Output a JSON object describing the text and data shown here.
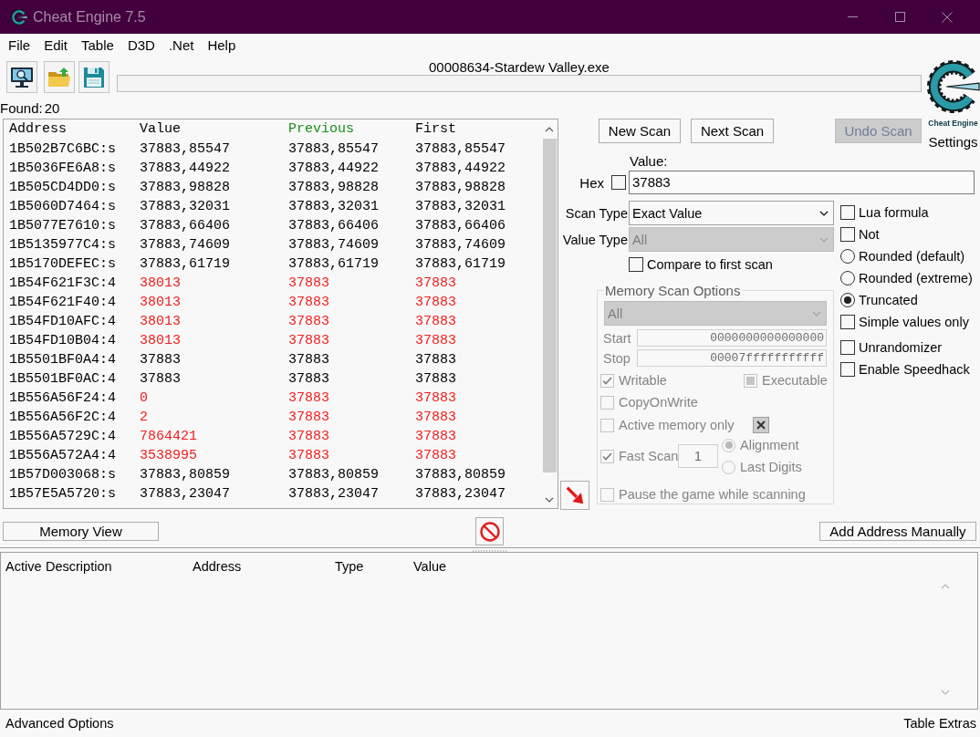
{
  "window": {
    "title": "Cheat Engine 7.5"
  },
  "menu": [
    {
      "label": "File"
    },
    {
      "label": "Edit"
    },
    {
      "label": "Table"
    },
    {
      "label": "D3D"
    },
    {
      "label": ".Net"
    },
    {
      "label": "Help"
    }
  ],
  "process": {
    "name": "00008634-Stardew Valley.exe",
    "progress": {
      "level": 0
    }
  },
  "found": {
    "label": "Found:",
    "count": "20"
  },
  "results": {
    "columns": [
      {
        "label": "Address",
        "color": "#000000"
      },
      {
        "label": "Value",
        "color": "#000000"
      },
      {
        "label": "Previous",
        "color": "#1a8f1a"
      },
      {
        "label": "First",
        "color": "#000000"
      }
    ],
    "rows": [
      {
        "address": "1B502B7C6BC:s",
        "value": "37883,85547",
        "previous": "37883,85547",
        "first": "37883,85547",
        "changed": false
      },
      {
        "address": "1B5036FE6A8:s",
        "value": "37883,44922",
        "previous": "37883,44922",
        "first": "37883,44922",
        "changed": false
      },
      {
        "address": "1B505CD4DD0:s",
        "value": "37883,98828",
        "previous": "37883,98828",
        "first": "37883,98828",
        "changed": false
      },
      {
        "address": "1B5060D7464:s",
        "value": "37883,32031",
        "previous": "37883,32031",
        "first": "37883,32031",
        "changed": false
      },
      {
        "address": "1B5077E7610:s",
        "value": "37883,66406",
        "previous": "37883,66406",
        "first": "37883,66406",
        "changed": false
      },
      {
        "address": "1B5135977C4:s",
        "value": "37883,74609",
        "previous": "37883,74609",
        "first": "37883,74609",
        "changed": false
      },
      {
        "address": "1B5170DEFEC:s",
        "value": "37883,61719",
        "previous": "37883,61719",
        "first": "37883,61719",
        "changed": false
      },
      {
        "address": "1B54F621F3C:4",
        "value": "38013",
        "previous": "37883",
        "first": "37883",
        "changed": true
      },
      {
        "address": "1B54F621F40:4",
        "value": "38013",
        "previous": "37883",
        "first": "37883",
        "changed": true
      },
      {
        "address": "1B54FD10AFC:4",
        "value": "38013",
        "previous": "37883",
        "first": "37883",
        "changed": true
      },
      {
        "address": "1B54FD10B04:4",
        "value": "38013",
        "previous": "37883",
        "first": "37883",
        "changed": true
      },
      {
        "address": "1B5501BF0A4:4",
        "value": "37883",
        "previous": "37883",
        "first": "37883",
        "changed": false
      },
      {
        "address": "1B5501BF0AC:4",
        "value": "37883",
        "previous": "37883",
        "first": "37883",
        "changed": false
      },
      {
        "address": "1B556A56F24:4",
        "value": "0",
        "previous": "37883",
        "first": "37883",
        "changed": true
      },
      {
        "address": "1B556A56F2C:4",
        "value": "2",
        "previous": "37883",
        "first": "37883",
        "changed": true
      },
      {
        "address": "1B556A5729C:4",
        "value": "7864421",
        "previous": "37883",
        "first": "37883",
        "changed": true
      },
      {
        "address": "1B556A572A4:4",
        "value": "3538995",
        "previous": "37883",
        "first": "37883",
        "changed": true
      },
      {
        "address": "1B57D003068:s",
        "value": "37883,80859",
        "previous": "37883,80859",
        "first": "37883,80859",
        "changed": false
      },
      {
        "address": "1B57E5A5720:s",
        "value": "37883,23047",
        "previous": "37883,23047",
        "first": "37883,23047",
        "changed": false
      }
    ]
  },
  "scan_buttons": [
    {
      "label": "New Scan",
      "disabled": false
    },
    {
      "label": "Next Scan",
      "disabled": false
    },
    {
      "label": "Undo Scan",
      "disabled": true
    }
  ],
  "logo": {
    "wordmark": "Cheat Engine",
    "caption": "Settings"
  },
  "value": {
    "label": "Value:",
    "value": "37883",
    "hex": {
      "label": "Hex",
      "checked": false
    }
  },
  "scan_type": {
    "label": "Scan Type",
    "value": "Exact Value",
    "disabled": false
  },
  "value_type": {
    "label": "Value Type",
    "value": "All",
    "disabled": true
  },
  "compare_to_first_scan": {
    "label": "Compare to first scan",
    "checked": false
  },
  "memory_scan_options": {
    "title": "Memory Scan Options",
    "disabled": true,
    "region": {
      "value": "All"
    },
    "start": {
      "label": "Start",
      "value": "0000000000000000"
    },
    "stop": {
      "label": "Stop",
      "value": "00007fffffffffff"
    },
    "writable": {
      "label": "Writable",
      "checked": true
    },
    "executable": {
      "label": "Executable",
      "checked": false,
      "indeterminate": true
    },
    "copy_on_write": {
      "label": "CopyOnWrite",
      "checked": false
    },
    "active_memory_only": {
      "label": "Active memory only",
      "checked": false
    },
    "fast_scan": {
      "label": "Fast Scan",
      "checked": true,
      "value": "1"
    },
    "alignment": [
      {
        "label": "Alignment",
        "selected": true
      },
      {
        "label": "Last Digits",
        "selected": false
      }
    ],
    "pause_game": {
      "label": "Pause the game while scanning",
      "checked": false
    }
  },
  "scan_options": [
    {
      "kind": "checkbox",
      "label": "Lua formula",
      "checked": false
    },
    {
      "kind": "checkbox",
      "label": "Not",
      "checked": false
    },
    {
      "kind": "radio",
      "label": "Rounded (default)",
      "selected": false
    },
    {
      "kind": "radio",
      "label": "Rounded (extreme)",
      "selected": false
    },
    {
      "kind": "radio",
      "label": "Truncated",
      "selected": true
    },
    {
      "kind": "checkbox",
      "label": "Simple values only",
      "checked": false
    }
  ],
  "extras": [
    {
      "kind": "checkbox",
      "label": "Unrandomizer",
      "checked": false
    },
    {
      "kind": "checkbox",
      "label": "Enable Speedhack",
      "checked": false
    }
  ],
  "memory_view_button": {
    "label": "Memory View"
  },
  "add_address_button": {
    "label": "Add Address Manually"
  },
  "address_list": {
    "columns": [
      {
        "label": "Active"
      },
      {
        "label": "Description"
      },
      {
        "label": "Address"
      },
      {
        "label": "Type"
      },
      {
        "label": "Value"
      }
    ]
  },
  "status_bar": {
    "left": "Advanced Options",
    "right": "Table Extras"
  }
}
